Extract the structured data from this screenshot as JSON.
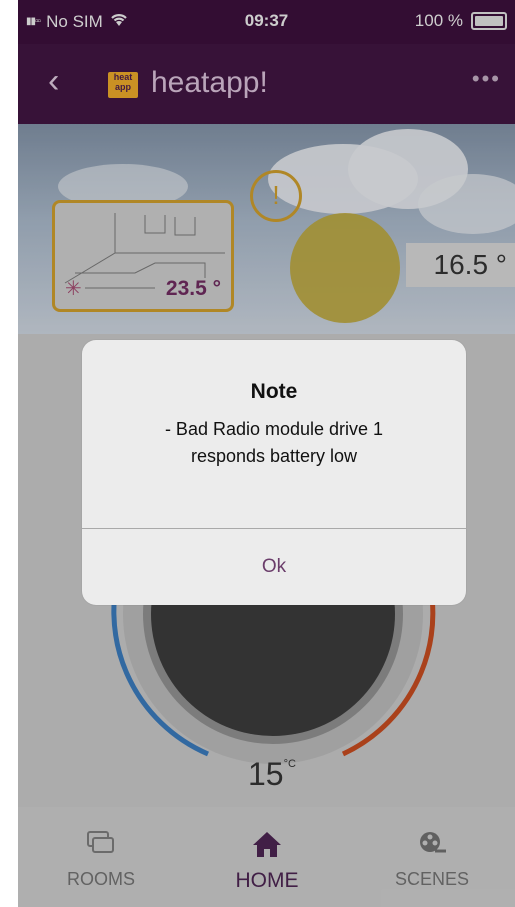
{
  "status_bar": {
    "carrier": "No SIM",
    "time": "09:37",
    "battery": "100 %"
  },
  "header": {
    "logo_text": "heat app",
    "title": "heatapp!",
    "more": "•••"
  },
  "room": {
    "temperature": "23.5 °"
  },
  "outside": {
    "temperature": "16.5 °"
  },
  "dial": {
    "setpoint_value": "15",
    "setpoint_unit": "°C"
  },
  "alert": {
    "title": "Note",
    "message_line1": "- Bad Radio module drive 1",
    "message_line2": "responds battery low",
    "ok_label": "Ok"
  },
  "tabs": [
    {
      "label": "ROOMS",
      "icon": "rooms-icon"
    },
    {
      "label": "HOME",
      "icon": "home-icon"
    },
    {
      "label": "SCENES",
      "icon": "scenes-icon"
    }
  ],
  "colors": {
    "header_purple": "#3f1540",
    "accent_gold": "#c99a2c",
    "active_tab": "#4a2450",
    "cold_arc": "#3a78b8",
    "warm_arc": "#c24a1f"
  }
}
